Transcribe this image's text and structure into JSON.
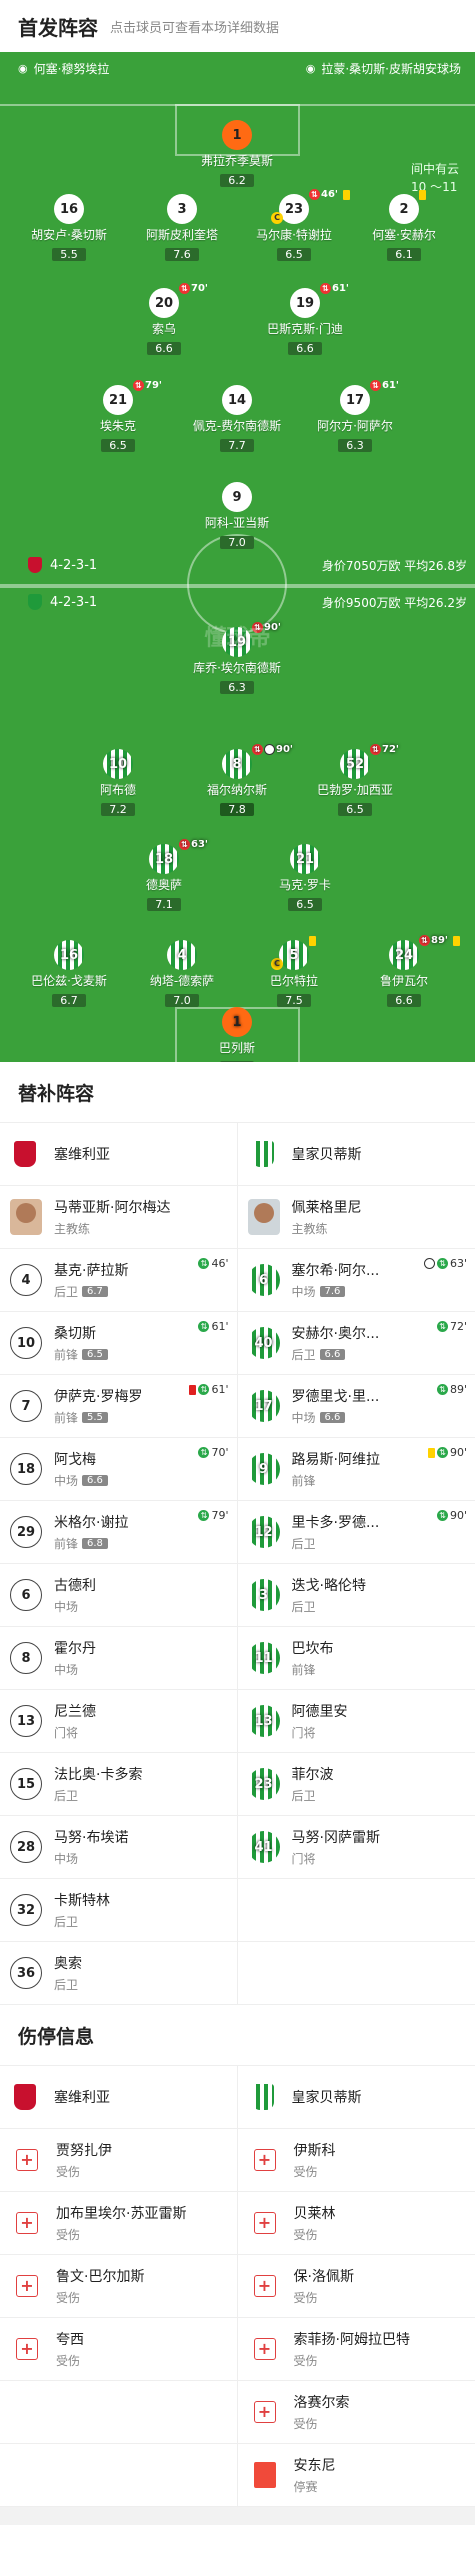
{
  "header": {
    "title": "首发阵容",
    "subtitle": "点击球员可查看本场详细数据"
  },
  "venue": {
    "home": "何塞·穆努埃拉",
    "away": "拉蒙·桑切斯·皮斯胡安球场"
  },
  "weather": {
    "condition": "间中有云",
    "temp": "10 ～11"
  },
  "home_team": {
    "formation": "4-2-3-1",
    "worth": "身价7050万欧 平均26.8岁"
  },
  "away_team": {
    "formation": "4-2-3-1",
    "worth": "身价9500万欧 平均26.2岁"
  },
  "watermark": "懂球帝",
  "home_players": [
    {
      "no": "1",
      "name": "弗拉乔季莫斯",
      "rating": "6.2",
      "gk": true
    },
    {
      "no": "16",
      "name": "胡安卢·桑切斯",
      "rating": "5.5"
    },
    {
      "no": "3",
      "name": "阿斯皮利奎塔",
      "rating": "7.6"
    },
    {
      "no": "23",
      "name": "马尔康·特谢拉",
      "rating": "6.5",
      "event": "46'",
      "cap": true,
      "yellow": true
    },
    {
      "no": "2",
      "name": "何塞·安赫尔",
      "rating": "6.1",
      "yellow": true
    },
    {
      "no": "20",
      "name": "索乌",
      "rating": "6.6",
      "event": "70'"
    },
    {
      "no": "19",
      "name": "巴斯克斯·门迪",
      "rating": "6.6",
      "event": "61'"
    },
    {
      "no": "21",
      "name": "埃朱克",
      "rating": "6.5",
      "event": "79'"
    },
    {
      "no": "14",
      "name": "佩克-费尔南德斯",
      "rating": "7.7"
    },
    {
      "no": "17",
      "name": "阿尔方·阿萨尔",
      "rating": "6.3",
      "event": "61'"
    },
    {
      "no": "9",
      "name": "阿科-亚当斯",
      "rating": "7.0"
    }
  ],
  "away_players": [
    {
      "no": "19",
      "name": "库乔·埃尔南德斯",
      "rating": "6.3",
      "event": "90'"
    },
    {
      "no": "10",
      "name": "阿布德",
      "rating": "7.2"
    },
    {
      "no": "8",
      "name": "福尔纳尔斯",
      "rating": "7.8",
      "event": "90'",
      "ball": true,
      "best": true
    },
    {
      "no": "52",
      "name": "巴勃罗·加西亚",
      "rating": "6.5",
      "event": "72'"
    },
    {
      "no": "18",
      "name": "德奥萨",
      "rating": "7.1",
      "event": "63'"
    },
    {
      "no": "21",
      "name": "马克·罗卡",
      "rating": "6.5"
    },
    {
      "no": "16",
      "name": "巴伦兹·戈麦斯",
      "rating": "6.7"
    },
    {
      "no": "4",
      "name": "纳塔-德索萨",
      "rating": "7.0"
    },
    {
      "no": "5",
      "name": "巴尔特拉",
      "rating": "7.5",
      "cap": true,
      "yellow": true
    },
    {
      "no": "24",
      "name": "鲁伊瓦尔",
      "rating": "6.6",
      "event": "89'",
      "yellow": true
    },
    {
      "no": "1",
      "name": "巴列斯",
      "rating": "7.2",
      "gk": true
    }
  ],
  "subs": {
    "title": "替补阵容",
    "home_team": "塞维利亚",
    "away_team": "皇家贝蒂斯",
    "home_coach": {
      "name": "马蒂亚斯·阿尔梅达",
      "role": "主教练"
    },
    "away_coach": {
      "name": "佩莱格里尼",
      "role": "主教练"
    },
    "rows": [
      [
        {
          "no": "4",
          "name": "基克·萨拉斯",
          "pos": "后卫",
          "rating": "6.7",
          "event": "46'"
        },
        {
          "no": "6",
          "name": "塞尔希·阿尔...",
          "pos": "中场",
          "rating": "7.6",
          "event": "63'",
          "ball": true
        }
      ],
      [
        {
          "no": "10",
          "name": "桑切斯",
          "pos": "前锋",
          "rating": "6.5",
          "event": "61'"
        },
        {
          "no": "40",
          "name": "安赫尔·奥尔...",
          "pos": "后卫",
          "rating": "6.6",
          "event": "72'"
        }
      ],
      [
        {
          "no": "7",
          "name": "伊萨克·罗梅罗",
          "pos": "前锋",
          "rating": "5.5",
          "event": "61'",
          "red": true
        },
        {
          "no": "17",
          "name": "罗德里戈·里...",
          "pos": "中场",
          "rating": "6.6",
          "event": "89'"
        }
      ],
      [
        {
          "no": "18",
          "name": "阿戈梅",
          "pos": "中场",
          "rating": "6.6",
          "event": "70'"
        },
        {
          "no": "9",
          "name": "路易斯·阿维拉",
          "pos": "前锋",
          "event": "90'",
          "yellow": true
        }
      ],
      [
        {
          "no": "29",
          "name": "米格尔·谢拉",
          "pos": "前锋",
          "rating": "6.8",
          "event": "79'"
        },
        {
          "no": "12",
          "name": "里卡多·罗德...",
          "pos": "后卫",
          "event": "90'"
        }
      ],
      [
        {
          "no": "6",
          "name": "古德利",
          "pos": "中场"
        },
        {
          "no": "3",
          "name": "迭戈·略伦特",
          "pos": "后卫"
        }
      ],
      [
        {
          "no": "8",
          "name": "霍尔丹",
          "pos": "中场"
        },
        {
          "no": "11",
          "name": "巴坎布",
          "pos": "前锋"
        }
      ],
      [
        {
          "no": "13",
          "name": "尼兰德",
          "pos": "门将"
        },
        {
          "no": "13",
          "name": "阿德里安",
          "pos": "门将"
        }
      ],
      [
        {
          "no": "15",
          "name": "法比奥·卡多索",
          "pos": "后卫"
        },
        {
          "no": "23",
          "name": "菲尔波",
          "pos": "后卫"
        }
      ],
      [
        {
          "no": "28",
          "name": "马努·布埃诺",
          "pos": "中场"
        },
        {
          "no": "41",
          "name": "马努·冈萨雷斯",
          "pos": "门将"
        }
      ],
      [
        {
          "no": "32",
          "name": "卡斯特林",
          "pos": "后卫"
        },
        null
      ],
      [
        {
          "no": "36",
          "name": "奥索",
          "pos": "后卫"
        },
        null
      ]
    ]
  },
  "injuries": {
    "title": "伤停信息",
    "home_team": "塞维利亚",
    "away_team": "皇家贝蒂斯",
    "rows": [
      [
        {
          "name": "贾努扎伊",
          "status": "受伤"
        },
        {
          "name": "伊斯科",
          "status": "受伤"
        }
      ],
      [
        {
          "name": "加布里埃尔·苏亚雷斯",
          "status": "受伤"
        },
        {
          "name": "贝莱林",
          "status": "受伤"
        }
      ],
      [
        {
          "name": "鲁文·巴尔加斯",
          "status": "受伤"
        },
        {
          "name": "保·洛佩斯",
          "status": "受伤"
        }
      ],
      [
        {
          "name": "夸西",
          "status": "受伤"
        },
        {
          "name": "索菲扬·阿姆拉巴特",
          "status": "受伤"
        }
      ],
      [
        null,
        {
          "name": "洛赛尔索",
          "status": "受伤"
        }
      ],
      [
        null,
        {
          "name": "安东尼",
          "status": "停赛",
          "suspended": true
        }
      ]
    ]
  },
  "colors": {
    "pitch": "#3aa13a",
    "away_stripe": "#1f9a3a",
    "gk": "#ff6a13",
    "yellow": "#ffd200",
    "red": "#e02020"
  }
}
